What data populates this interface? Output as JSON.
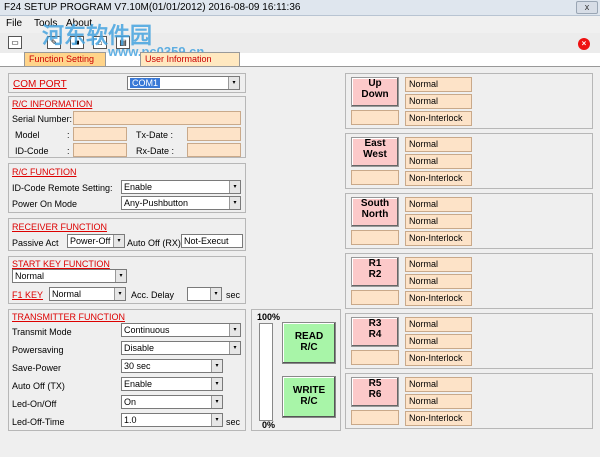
{
  "window": {
    "title": "F24 SETUP PROGRAM V7.10M(01/01/2012)  2016-08-09  16:11:36",
    "close": "x"
  },
  "menu": {
    "file": "File",
    "tools": "Tools",
    "about": "About"
  },
  "watermark": {
    "text": "河东软件园",
    "url": "www.pc0359.cn"
  },
  "tabs": {
    "function_setting": "Function Setting",
    "user_information": "User Information"
  },
  "com": {
    "label": "COM  PORT",
    "value": "COM1"
  },
  "rc_info": {
    "title": "R/C INFORMATION",
    "serial": "Serial Number:",
    "model": "Model",
    "tx_date": "Tx-Date :",
    "id_code": "ID-Code",
    "rx_date": "Rx-Date :",
    "colon": ":"
  },
  "rc_function": {
    "title": "R/C  FUNCTION",
    "id_remote_label": "ID-Code Remote Setting:",
    "id_remote_value": "Enable",
    "power_on_label": "Power On Mode",
    "power_on_value": "Any-Pushbutton"
  },
  "receiver": {
    "title": "RECEIVER  FUNCTION",
    "passive_label": "Passive Act",
    "passive_value": "Power-Off",
    "autooff_label": "Auto Off (RX):",
    "autooff_value": "Not-Execut"
  },
  "startkey": {
    "title": "START KEY FUNCTION",
    "value": "Normal",
    "f1_label": "F1 KEY",
    "f1_value": "Normal",
    "acc_label": "Acc. Delay",
    "acc_value": "",
    "acc_unit": "sec"
  },
  "transmitter": {
    "title": "TRANSMITTER FUNCTION",
    "rows": [
      {
        "label": "Transmit Mode",
        "value": "Continuous"
      },
      {
        "label": "Powersaving",
        "value": "Disable"
      },
      {
        "label": "Save-Power",
        "value": "30 sec"
      },
      {
        "label": "Auto Off (TX)",
        "value": "Enable"
      },
      {
        "label": "Led-On/Off",
        "value": "On"
      },
      {
        "label": "Led-Off-Time",
        "value": "1.0",
        "unit": "sec"
      }
    ]
  },
  "progress": {
    "top": "100%",
    "bottom": "0%",
    "value": 0
  },
  "actions": {
    "read_line1": "READ",
    "read_line2": "R/C",
    "write_line1": "WRITE",
    "write_line2": "R/C"
  },
  "buttons": [
    {
      "line1": "Up",
      "line2": "Down",
      "s1": "Normal",
      "s2": "Normal",
      "s3": "Non-Interlock"
    },
    {
      "line1": "East",
      "line2": "West",
      "s1": "Normal",
      "s2": "Normal",
      "s3": "Non-Interlock"
    },
    {
      "line1": "South",
      "line2": "North",
      "s1": "Normal",
      "s2": "Normal",
      "s3": "Non-Interlock"
    },
    {
      "line1": "R1",
      "line2": "R2",
      "s1": "Normal",
      "s2": "Normal",
      "s3": "Non-Interlock"
    },
    {
      "line1": "R3",
      "line2": "R4",
      "s1": "Normal",
      "s2": "Normal",
      "s3": "Non-Interlock"
    },
    {
      "line1": "R5",
      "line2": "R6",
      "s1": "Normal",
      "s2": "Normal",
      "s3": "Non-Interlock"
    }
  ],
  "icons": {
    "arrow": "▾"
  }
}
